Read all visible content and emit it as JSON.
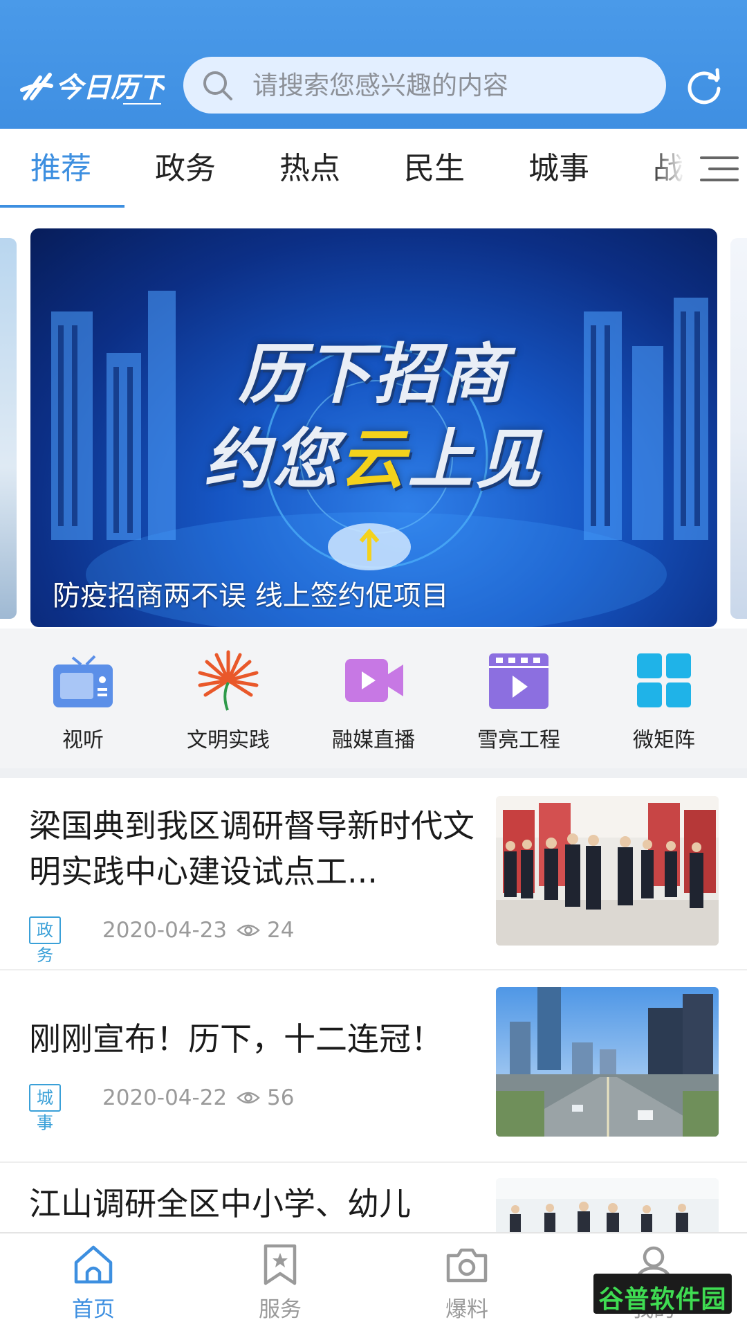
{
  "header": {
    "logo_text": "今日历下",
    "search_placeholder": "请搜索您感兴趣的内容",
    "refresh_icon": "refresh-icon"
  },
  "tabs": [
    {
      "label": "推荐",
      "active": true
    },
    {
      "label": "政务",
      "active": false
    },
    {
      "label": "热点",
      "active": false
    },
    {
      "label": "民生",
      "active": false
    },
    {
      "label": "城事",
      "active": false
    },
    {
      "label": "战",
      "active": false
    }
  ],
  "banner": {
    "title_line1": "历下招商",
    "title_line2_a": "约您",
    "title_line2_b": "云",
    "title_line2_c": "上见",
    "caption": "防疫招商两不误 线上签约促项目"
  },
  "quick_entries": [
    {
      "label": "视听",
      "icon": "tv-icon"
    },
    {
      "label": "文明实践",
      "icon": "flower-icon"
    },
    {
      "label": "融媒直播",
      "icon": "video-camera-icon"
    },
    {
      "label": "雪亮工程",
      "icon": "film-icon"
    },
    {
      "label": "微矩阵",
      "icon": "grid-icon"
    }
  ],
  "news": [
    {
      "title": "梁国典到我区调研督导新时代文明实践中心建设试点工...",
      "tag": "政务",
      "date": "2020-04-23",
      "views": "24"
    },
    {
      "title": "刚刚宣布！历下，十二连冠！",
      "tag": "城事",
      "date": "2020-04-22",
      "views": "56"
    },
    {
      "title": "江山调研全区中小学、幼儿",
      "tag": "",
      "date": "",
      "views": ""
    }
  ],
  "bottom_nav": [
    {
      "label": "首页",
      "icon": "home-icon",
      "active": true
    },
    {
      "label": "服务",
      "icon": "bookmark-star-icon",
      "active": false
    },
    {
      "label": "爆料",
      "icon": "camera-icon",
      "active": false
    },
    {
      "label": "我的",
      "icon": "user-icon",
      "active": false
    }
  ],
  "watermark": "谷普软件园",
  "colors": {
    "header_blue": "#4a9ae9",
    "accent": "#3d8fe0",
    "tag_border": "#3aa0d8"
  }
}
